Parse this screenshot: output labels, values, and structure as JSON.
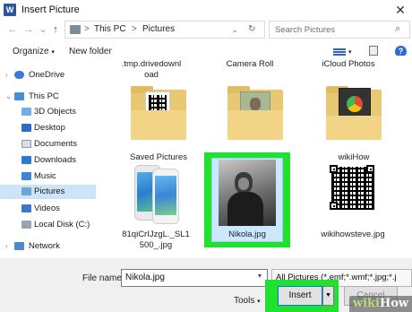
{
  "window": {
    "title": "Insert Picture",
    "app_icon_letter": "W"
  },
  "address": {
    "crumbs": [
      "This PC",
      "Pictures"
    ],
    "separator": ">",
    "search_placeholder": "Search Pictures"
  },
  "toolbar": {
    "organize_label": "Organize",
    "new_folder_label": "New folder",
    "help_label": "?"
  },
  "nav": {
    "items": [
      {
        "label": "OneDrive",
        "icon": "cloud-icon"
      },
      {
        "label": "This PC",
        "icon": "computer-icon"
      },
      {
        "label": "3D Objects",
        "icon": "cube-icon"
      },
      {
        "label": "Desktop",
        "icon": "desktop-icon"
      },
      {
        "label": "Documents",
        "icon": "document-icon"
      },
      {
        "label": "Downloads",
        "icon": "download-icon"
      },
      {
        "label": "Music",
        "icon": "music-icon"
      },
      {
        "label": "Pictures",
        "icon": "pictures-icon",
        "selected": true
      },
      {
        "label": "Videos",
        "icon": "video-icon"
      },
      {
        "label": "Local Disk (C:)",
        "icon": "disk-icon"
      },
      {
        "label": "Network",
        "icon": "network-icon"
      }
    ]
  },
  "files": {
    "top_row": [
      "tmp.drivedownl oad",
      "Camera Roll",
      "iCloud Photos"
    ],
    "top_row_line1": [
      ".tmp.drivedownl",
      "Camera Roll",
      "iCloud Photos"
    ],
    "top_row_line2": [
      "oad",
      "",
      ""
    ],
    "row2": [
      "Saved Pictures",
      "wikiHow"
    ],
    "row3": [
      "81qiCrIJzgL._SL1",
      "Nikola.jpg",
      "wikihowsteve.jpg"
    ],
    "row3_line2": "500_.jpg",
    "selected": "Nikola.jpg"
  },
  "bottom": {
    "file_name_label": "File name:",
    "file_name_value": "Nikola.jpg",
    "filter_value": "All Pictures (*.emf;*.wmf;*.jpg;*.j",
    "tools_label": "Tools",
    "insert_label": "Insert",
    "cancel_label": "Cancel"
  },
  "watermark": "wikiHow",
  "colors": {
    "highlight_green": "#22e02e",
    "selection_blue": "#cce4f7",
    "accent_blue": "#0078d7"
  }
}
